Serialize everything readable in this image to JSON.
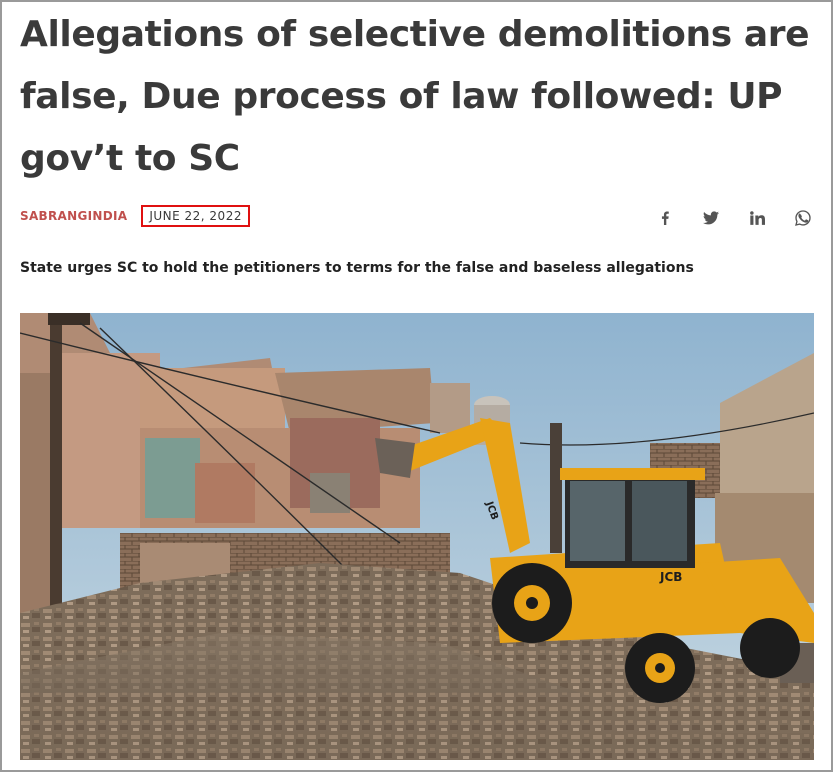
{
  "article": {
    "headline": "Allegations of selective demolitions are false, Due process of law followed: UP gov’t to SC",
    "author": "SABRANGINDIA",
    "date": "JUNE 22, 2022",
    "subtitle": "State urges SC to hold the petitioners to terms for the false and baseless allegations"
  },
  "share": {
    "icons": [
      "facebook-icon",
      "twitter-icon",
      "linkedin-icon",
      "whatsapp-icon"
    ]
  },
  "colors": {
    "headline": "#3a3a3a",
    "author": "#c0504d",
    "date_highlight": "#e01010",
    "machine_yellow": "#e8a317"
  },
  "image": {
    "machine_brand": "JCB"
  }
}
